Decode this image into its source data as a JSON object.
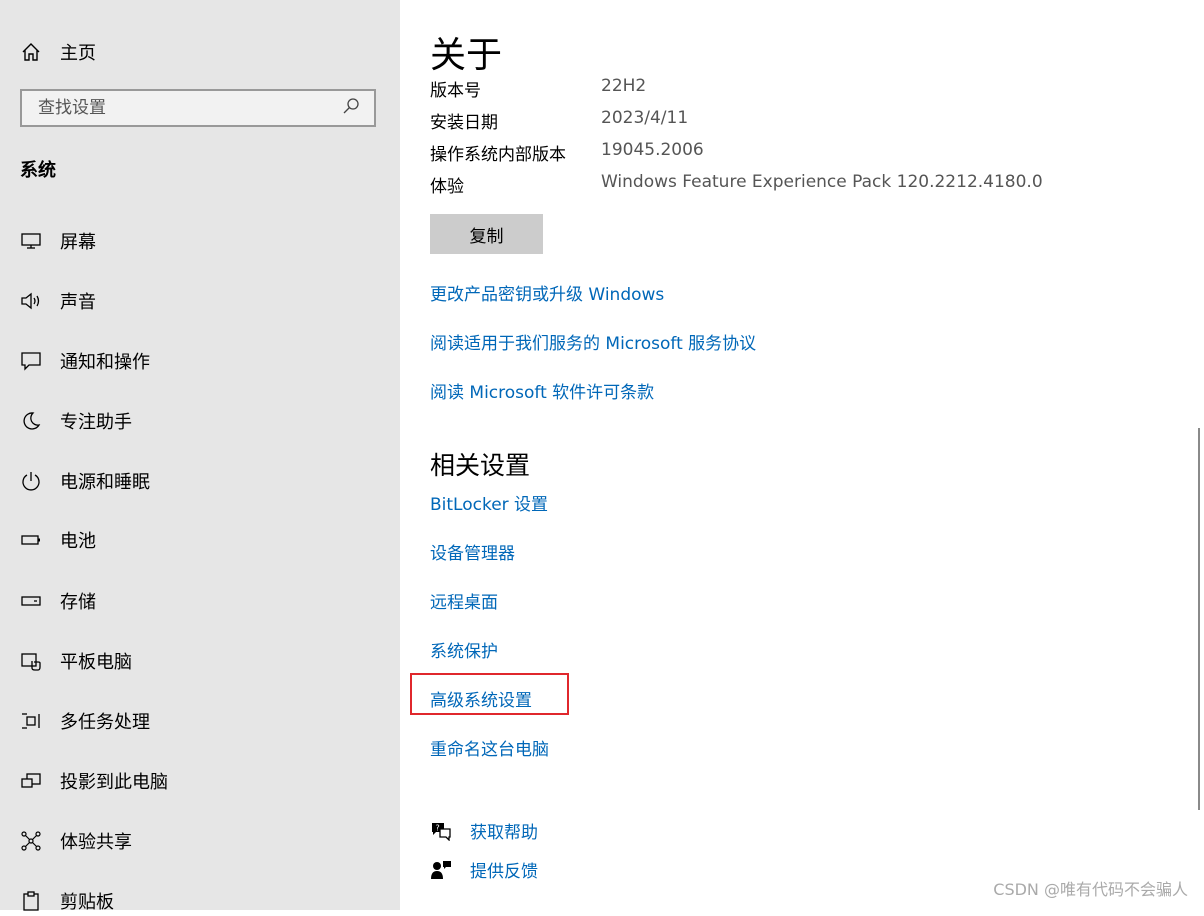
{
  "sidebar": {
    "home_label": "主页",
    "search_placeholder": "查找设置",
    "section_title": "系统",
    "items": [
      {
        "label": "屏幕",
        "icon": "monitor-icon"
      },
      {
        "label": "声音",
        "icon": "speaker-icon"
      },
      {
        "label": "通知和操作",
        "icon": "notification-icon"
      },
      {
        "label": "专注助手",
        "icon": "moon-icon"
      },
      {
        "label": "电源和睡眠",
        "icon": "power-icon"
      },
      {
        "label": "电池",
        "icon": "battery-icon"
      },
      {
        "label": "存储",
        "icon": "storage-icon"
      },
      {
        "label": "平板电脑",
        "icon": "tablet-icon"
      },
      {
        "label": "多任务处理",
        "icon": "multitask-icon"
      },
      {
        "label": "投影到此电脑",
        "icon": "project-icon"
      },
      {
        "label": "体验共享",
        "icon": "share-icon"
      },
      {
        "label": "剪贴板",
        "icon": "clipboard-icon"
      }
    ]
  },
  "main": {
    "title": "关于",
    "info": [
      {
        "key": "版本号",
        "value": "22H2"
      },
      {
        "key": "安装日期",
        "value": "2023/4/11"
      },
      {
        "key": "操作系统内部版本",
        "value": "19045.2006"
      },
      {
        "key": "体验",
        "value": "Windows Feature Experience Pack 120.2212.4180.0"
      }
    ],
    "copy_label": "复制",
    "links": [
      "更改产品密钥或升级 Windows",
      "阅读适用于我们服务的 Microsoft 服务协议",
      "阅读 Microsoft 软件许可条款"
    ],
    "related_title": "相关设置",
    "related_links": [
      "BitLocker 设置",
      "设备管理器",
      "远程桌面",
      "系统保护",
      "高级系统设置",
      "重命名这台电脑"
    ],
    "help": [
      {
        "label": "获取帮助",
        "icon": "help-chat-icon"
      },
      {
        "label": "提供反馈",
        "icon": "feedback-icon"
      }
    ]
  },
  "watermark": "CSDN @唯有代码不会骗人",
  "colors": {
    "link": "#0067b8",
    "highlight": "#e0272c",
    "sidebar_bg": "#e6e6e6"
  }
}
